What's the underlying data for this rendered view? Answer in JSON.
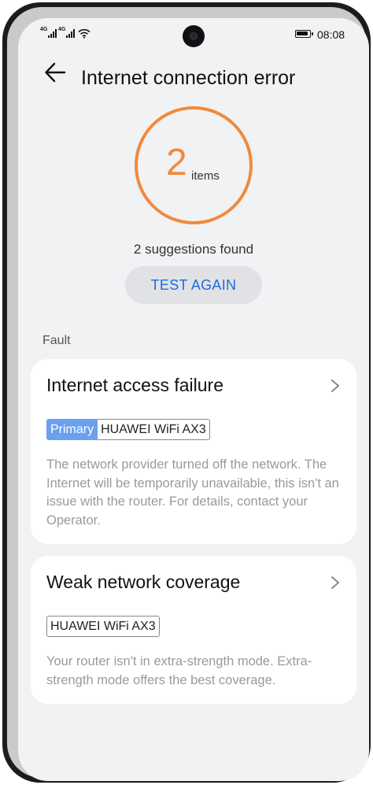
{
  "status_bar": {
    "signal1_tag": "4G",
    "signal2_tag": "4G",
    "time": "08:08"
  },
  "header": {
    "back_icon": "arrow-left-icon",
    "title": "Internet connection error"
  },
  "summary": {
    "count": "2",
    "unit": "items",
    "suggestions": "2 suggestions found",
    "test_again_label": "TEST AGAIN",
    "ring_color": "#f08a3c",
    "accent_color": "#1c6cde"
  },
  "fault_section": {
    "label": "Fault",
    "cards": [
      {
        "title": "Internet access failure",
        "primary_tag": "Primary",
        "device": "HUAWEI WiFi AX3",
        "description": "The network provider turned off the network. The Internet will be temporarily unavailable, this isn't an issue with the router. For details, contact your Operator."
      },
      {
        "title": "Weak network coverage",
        "device": "HUAWEI WiFi AX3",
        "description": "Your router isn't in extra-strength mode. Extra-strength mode offers the best coverage."
      }
    ]
  }
}
